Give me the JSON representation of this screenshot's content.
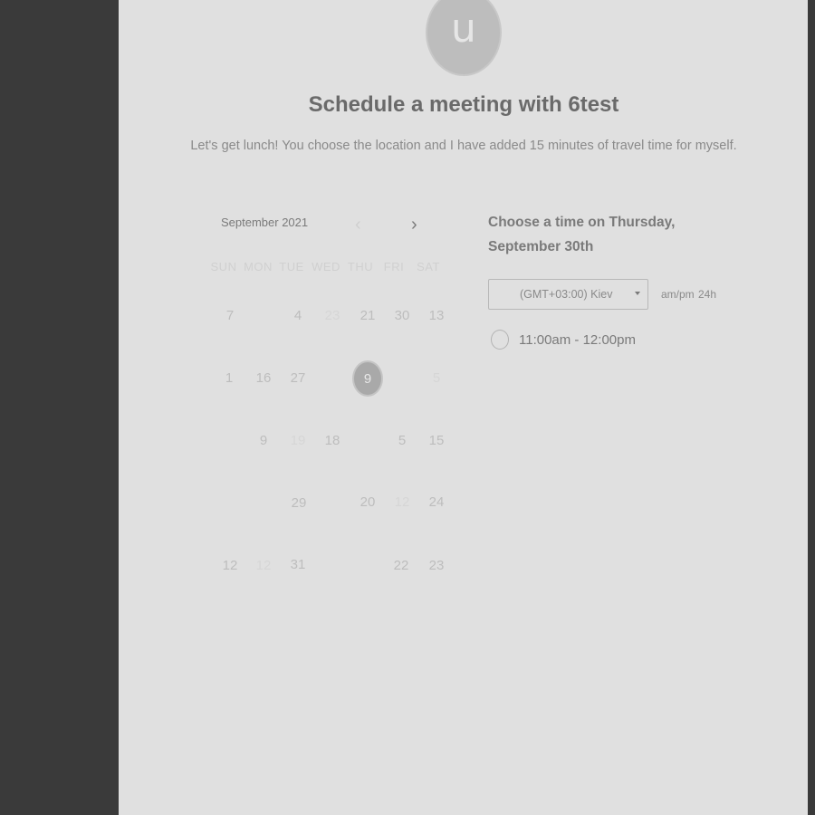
{
  "avatar": {
    "letter": "u"
  },
  "header": {
    "title": "Schedule a meeting with 6test",
    "subtitle": "Let's get lunch! You choose the location and I have added 15 minutes of travel time for myself."
  },
  "calendar": {
    "month_label": "September 2021",
    "prev_icon": "chevron-left-icon",
    "next_icon": "chevron-right-icon",
    "weekdays": [
      "SUN",
      "MON",
      "TUE",
      "WED",
      "THU",
      "FRI",
      "SAT"
    ],
    "selected_day": "9",
    "rows": [
      [
        "7",
        "",
        "4",
        "23",
        "21",
        "30",
        "13"
      ],
      [
        "1",
        "16",
        "27",
        "",
        "9",
        "",
        "5"
      ],
      [
        "",
        "9",
        "19",
        "18",
        "",
        "5",
        "15"
      ],
      [
        "",
        "",
        "29",
        "",
        "20",
        "12",
        "24"
      ],
      [
        "12",
        "12",
        "31",
        "",
        "",
        "22",
        "23"
      ]
    ]
  },
  "time_picker": {
    "heading": "Choose a time on Thursday, September 30th",
    "timezone": "(GMT+03:00) Kiev",
    "format_ampm": "am/pm",
    "format_24h": "24h",
    "slots": [
      {
        "label": "11:00am - 12:00pm"
      }
    ]
  },
  "colors": {
    "background": "#3a3a3a",
    "panel": "#e0e0e0",
    "text_primary": "#6a6a6a",
    "text_muted": "#bdbdbd"
  }
}
